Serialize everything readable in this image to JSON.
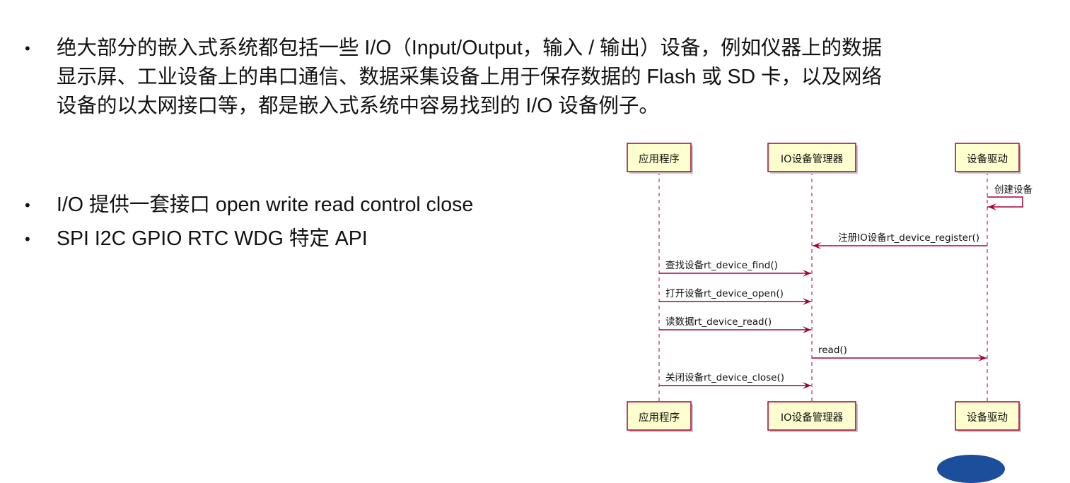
{
  "paragraph_lines": [
    "绝大部分的嵌入式系统都包括一些 I/O（Input/Output，输入 / 输出）设备，例如仪器上的数据",
    "显示屏、工业设备上的串口通信、数据采集设备上用于保存数据的 Flash 或 SD 卡，以及网络",
    "设备的以太网接口等，都是嵌入式系统中容易找到的 I/O 设备例子。"
  ],
  "bullets": [
    "I/O 提供一套接口 open write read control close",
    "SPI I2C GPIO RTC WDG 特定 API"
  ],
  "bullet_symbol": "•",
  "sequence_diagram": {
    "participants": [
      "应用程序",
      "IO设备管理器",
      "设备驱动"
    ],
    "messages": [
      {
        "from": 2,
        "to": 2,
        "label": "创建设备"
      },
      {
        "from": 2,
        "to": 1,
        "label": "注册IO设备rt_device_register()"
      },
      {
        "from": 0,
        "to": 1,
        "label": "查找设备rt_device_find()"
      },
      {
        "from": 0,
        "to": 1,
        "label": "打开设备rt_device_open()"
      },
      {
        "from": 0,
        "to": 1,
        "label": "读数据rt_device_read()"
      },
      {
        "from": 1,
        "to": 2,
        "label": "read()"
      },
      {
        "from": 0,
        "to": 1,
        "label": "关闭设备rt_device_close()"
      }
    ],
    "colors": {
      "box_fill": "#fefece",
      "box_border": "#a80036",
      "lifeline": "#a80036",
      "arrow": "#a80036"
    }
  }
}
